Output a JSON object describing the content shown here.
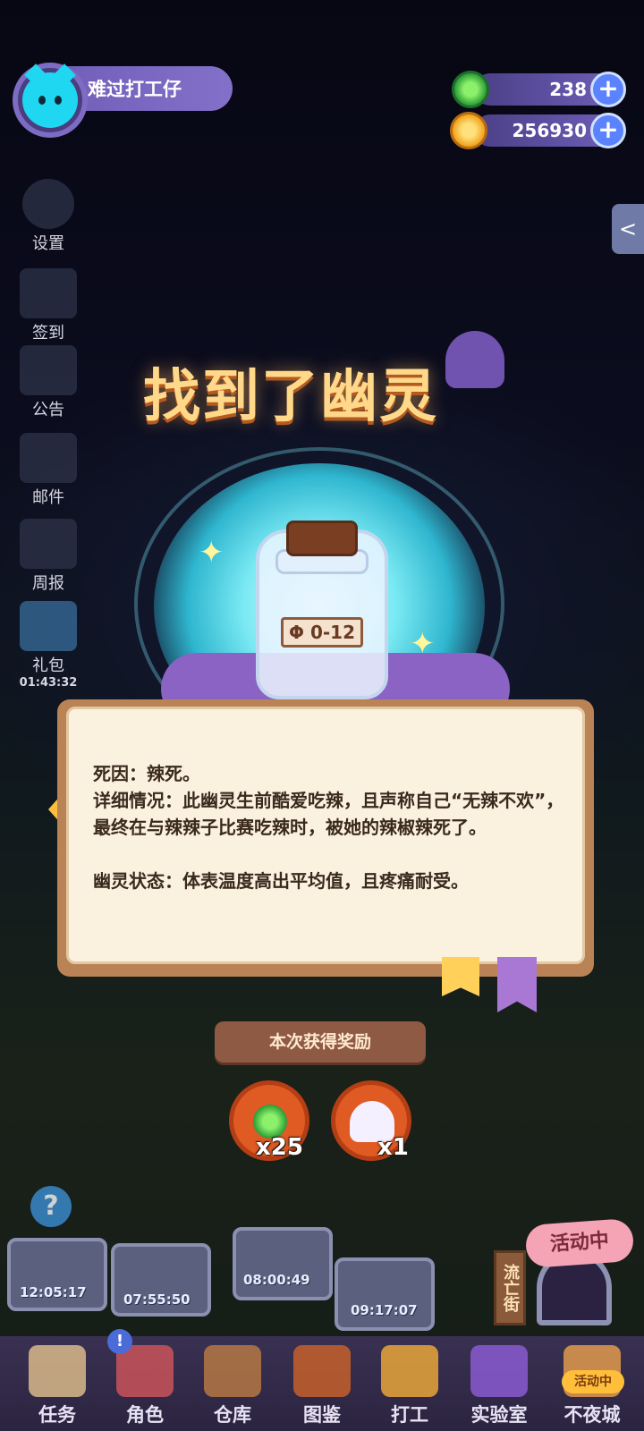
{
  "player": {
    "name": "难过打工仔"
  },
  "currencies": {
    "gems": {
      "value": "238",
      "color": "#37c84a"
    },
    "coins": {
      "value": "256930",
      "color": "#f4b634"
    }
  },
  "side_menu": [
    {
      "label": "设置",
      "icon": "gear-icon"
    },
    {
      "label": "签到",
      "icon": "calendar-icon"
    },
    {
      "label": "公告",
      "icon": "megaphone-icon"
    },
    {
      "label": "邮件",
      "icon": "mail-icon"
    },
    {
      "label": "周报",
      "icon": "newspaper-icon"
    },
    {
      "label": "礼包",
      "icon": "gift-icon",
      "timer": "01:43:32"
    }
  ],
  "popup": {
    "title": "找到了幽灵",
    "bottle_label": "Φ 0-12",
    "lines": [
      "死因：辣死。",
      "详细情况：此幽灵生前酷爱吃辣，且声称自己“无辣不欢”，最终在与辣辣子比赛吃辣时，被她的辣椒辣死了。",
      "幽灵状态：体表温度高出平均值，且疼痛耐受。"
    ],
    "reward_title": "本次获得奖励",
    "rewards": [
      {
        "icon": "gem-icon",
        "count": "x25"
      },
      {
        "icon": "ghost-icon",
        "count": "x1"
      }
    ]
  },
  "stations": [
    "12:05:17",
    "07:55:50",
    "08:00:49",
    "09:17:07"
  ],
  "event": {
    "badge": "活动中",
    "street": "流亡街"
  },
  "bottom_nav": [
    {
      "label": "任务",
      "icon": "task-icon"
    },
    {
      "label": "角色",
      "icon": "character-icon",
      "badge": "!"
    },
    {
      "label": "仓库",
      "icon": "warehouse-icon"
    },
    {
      "label": "图鉴",
      "icon": "book-icon"
    },
    {
      "label": "打工",
      "icon": "work-icon"
    },
    {
      "label": "实验室",
      "icon": "lab-icon"
    },
    {
      "label": "不夜城",
      "icon": "city-icon",
      "badge": "活动中"
    }
  ],
  "colors": {
    "accent": "#7e6cc4",
    "reward_bg": "#e05a24",
    "page": "#fbf1df"
  }
}
